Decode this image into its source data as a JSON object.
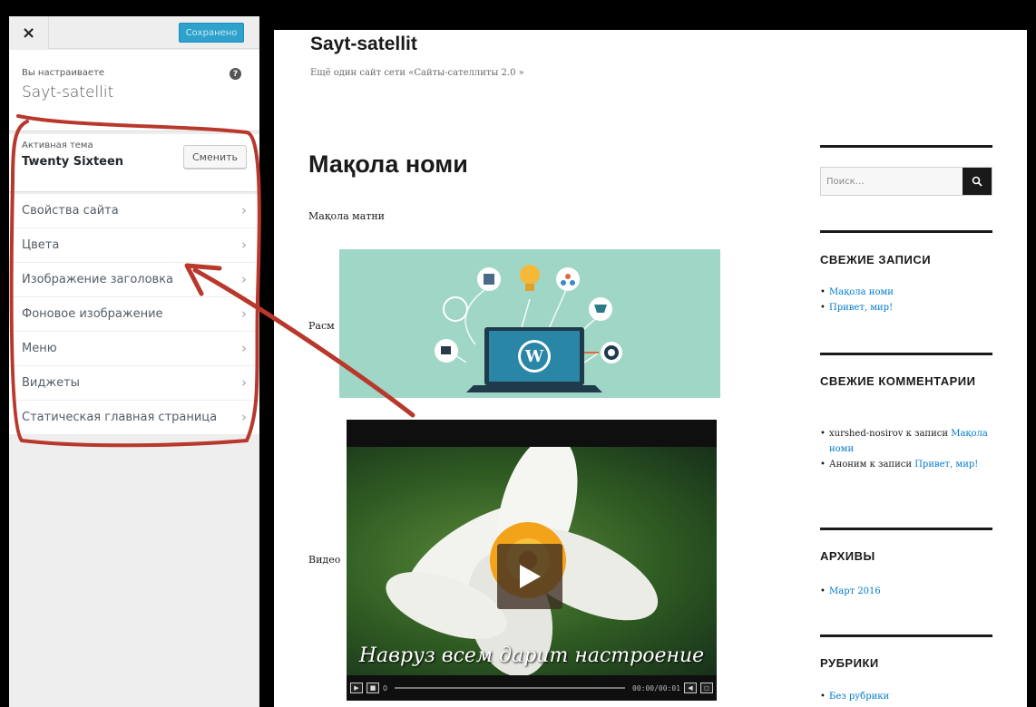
{
  "customizer": {
    "close_icon": "×",
    "save_label": "Сохранено",
    "customizing_label": "Вы настраиваете",
    "site_name": "Sayt-satellit",
    "help_icon": "?",
    "active_theme_label": "Активная тема",
    "active_theme_name": "Twenty Sixteen",
    "change_button": "Сменить",
    "panels": [
      {
        "label": "Свойства сайта"
      },
      {
        "label": "Цвета"
      },
      {
        "label": "Изображение заголовка"
      },
      {
        "label": "Фоновое изображение"
      },
      {
        "label": "Меню"
      },
      {
        "label": "Виджеты"
      },
      {
        "label": "Статическая главная страница"
      }
    ],
    "chevron_icon": "chevron-right-icon"
  },
  "preview": {
    "site_title": "Sayt-satellit",
    "site_description": "Ещё один сайт сети «Сайты-сателлиты 2.0 »",
    "post_title": "Мақола номи",
    "post_text": "Мақола матни",
    "image_label": "Расм",
    "video_label": "Видео",
    "video_caption": "Навруз всем дарит настроение",
    "video_time": "00:00/00:01",
    "video_progress_start": "0",
    "search_placeholder": "Поиск…",
    "widgets": {
      "recent_posts_title": "СВЕЖИЕ ЗАПИСИ",
      "recent_posts": [
        "Мақола номи",
        "Привет, мир!"
      ],
      "recent_comments_title": "СВЕЖИЕ КОММЕНТАРИИ",
      "recent_comments": [
        {
          "author": "xurshed-nosirov",
          "connector": "к записи",
          "post": "Мақола номи"
        },
        {
          "author": "Аноним",
          "connector": "к записи",
          "post": "Привет, мир!"
        }
      ],
      "archives_title": "АРХИВЫ",
      "archives": [
        "Март 2016"
      ],
      "categories_title": "РУБРИКИ",
      "categories": [
        "Без рубрики"
      ]
    }
  },
  "colors": {
    "save_button": "#2ea2cc",
    "annotation_red": "#b8382c",
    "link": "#007acc"
  }
}
